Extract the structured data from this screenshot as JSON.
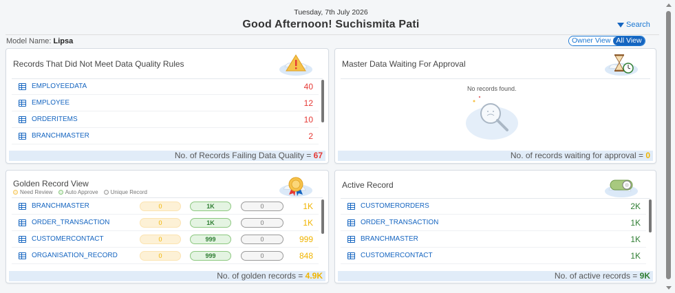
{
  "header": {
    "date": "Tuesday, 7th July 2026",
    "greeting": "Good Afternoon! Suchismita Pati",
    "search_label": "Search"
  },
  "model": {
    "label": "Model Name: ",
    "value": "Lipsa"
  },
  "view_toggle": {
    "owner_label": "Owner View",
    "all_label": "All View",
    "selected": "All View"
  },
  "quality_card": {
    "title": "Records That Did Not Meet Data Quality Rules",
    "rows": [
      {
        "name": "EMPLOYEEDATA",
        "count": "40"
      },
      {
        "name": "EMPLOYEE",
        "count": "12"
      },
      {
        "name": "ORDERITEMS",
        "count": "10"
      },
      {
        "name": "BRANCHMASTER",
        "count": "2"
      }
    ],
    "footer_label": "No. of Records Failing Data Quality = ",
    "footer_value": "67"
  },
  "approval_card": {
    "title": "Master Data Waiting For Approval",
    "empty_message": "No records found.",
    "footer_label": "No. of records waiting for approval = ",
    "footer_value": "0"
  },
  "golden_card": {
    "title": "Golden Record View",
    "legend": {
      "review": "Need Review",
      "auto": "Auto Approve",
      "unique": "Unique Record"
    },
    "rows": [
      {
        "name": "BRANCHMASTER",
        "review": "0",
        "auto": "1K",
        "unique": "0",
        "total": "1K"
      },
      {
        "name": "ORDER_TRANSACTION",
        "review": "0",
        "auto": "1K",
        "unique": "0",
        "total": "1K"
      },
      {
        "name": "CUSTOMERCONTACT",
        "review": "0",
        "auto": "999",
        "unique": "0",
        "total": "999"
      },
      {
        "name": "ORGANISATION_RECORD",
        "review": "0",
        "auto": "999",
        "unique": "0",
        "total": "848"
      }
    ],
    "footer_label": "No. of golden records = ",
    "footer_value": "4.9K"
  },
  "active_card": {
    "title": "Active Record",
    "rows": [
      {
        "name": "CUSTOMERORDERS",
        "count": "2K"
      },
      {
        "name": "ORDER_TRANSACTION",
        "count": "1K"
      },
      {
        "name": "BRANCHMASTER",
        "count": "1K"
      },
      {
        "name": "CUSTOMERCONTACT",
        "count": "1K"
      }
    ],
    "footer_label": "No. of active records = ",
    "footer_value": "9K"
  },
  "colors": {
    "accent": "#1565c0",
    "red": "#e53935",
    "yellow": "#f0b400",
    "green": "#2e7d32",
    "footer_bg": "#e1ecf8"
  }
}
